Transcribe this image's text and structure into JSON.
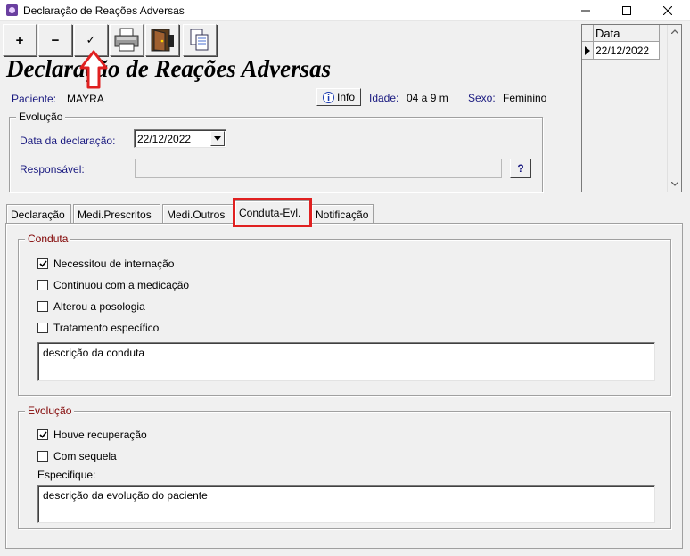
{
  "window": {
    "title": "Declaração de Reações Adversas",
    "minimize": "—",
    "maximize": "☐",
    "close": "✕"
  },
  "toolbar": {
    "add_label": "+",
    "remove_label": "−",
    "confirm_label": "✓"
  },
  "heading": "Declaração de Reações Adversas",
  "patient": {
    "label": "Paciente:",
    "name": "MAYRA",
    "info_button": "Info",
    "age_label": "Idade:",
    "age": "04 a 9 m",
    "sex_label": "Sexo:",
    "sex": "Feminino"
  },
  "evolucao_group": {
    "legend": "Evolução",
    "date_label": "Data da declaração:",
    "date_value": "22/12/2022",
    "responsavel_label": "Responsável:",
    "responsavel_value": "",
    "help_button": "?"
  },
  "grid": {
    "header": "Data",
    "rows": [
      "22/12/2022"
    ]
  },
  "tabs": [
    {
      "label": "Declaração"
    },
    {
      "label": "Medi.Prescritos"
    },
    {
      "label": "Medi.Outros"
    },
    {
      "label": "Conduta-Evl."
    },
    {
      "label": "Notificação"
    }
  ],
  "conduta": {
    "legend": "Conduta",
    "checkboxes": [
      {
        "label": "Necessitou de internação",
        "checked": true
      },
      {
        "label": "Continuou com a medicação",
        "checked": false
      },
      {
        "label": "Alterou a posologia",
        "checked": false
      },
      {
        "label": "Tratamento específico",
        "checked": false
      }
    ],
    "memo": "descrição da conduta"
  },
  "evolucao": {
    "legend": "Evolução",
    "checkboxes": [
      {
        "label": "Houve recuperação",
        "checked": true
      },
      {
        "label": "Com sequela",
        "checked": false
      }
    ],
    "especifique_label": "Especifique:",
    "memo": "descrição da evolução do paciente"
  },
  "colors": {
    "highlight": "#e02020",
    "label_blue": "#1a1a80",
    "legend_red": "#800000"
  }
}
